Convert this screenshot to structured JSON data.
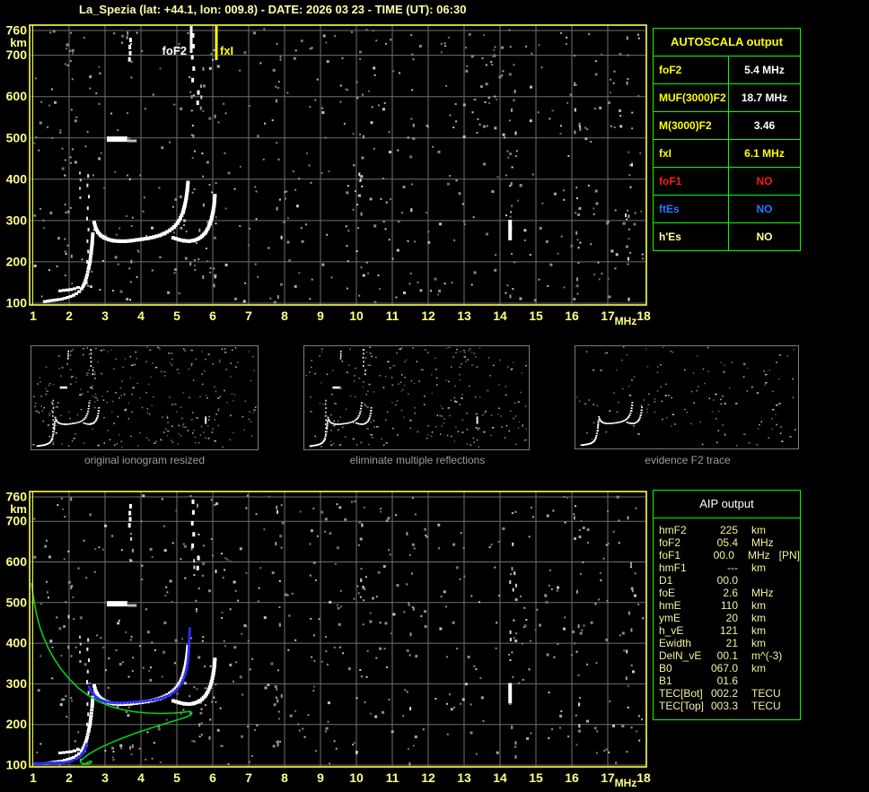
{
  "header": {
    "title": "La_Spezia (lat: +44.1, lon: 009.8) - DATE: 2026 03 23 - TIME (UT): 06:30"
  },
  "colors": {
    "background": "#000000",
    "plot_border": "#ffff4a",
    "grid": "#6f6f6f",
    "axis_text": "#ffff8c",
    "trace": "#ffffff",
    "noise": "#8c8c8c",
    "profile_green": "#00d020",
    "restored_blue": "#2c2cff",
    "table_border": "#00ff00",
    "caption_gray": "#9c9c9c",
    "aip_text": "#f2f2a2"
  },
  "autoscala_table": {
    "title": "AUTOSCALA output",
    "rows": [
      {
        "label": "foF2",
        "value": "5.4 MHz",
        "label_color": "#ffff00",
        "value_color": "#ffffff"
      },
      {
        "label": "MUF(3000)F2",
        "value": "18.7 MHz",
        "label_color": "#ffff00",
        "value_color": "#ffffff"
      },
      {
        "label": "M(3000)F2",
        "value": "3.46",
        "label_color": "#ffff00",
        "value_color": "#ffffff"
      },
      {
        "label": "fxI",
        "value": "6.1 MHz",
        "label_color": "#ffff00",
        "value_color": "#ffff00"
      },
      {
        "label": "foF1",
        "value": "NO",
        "label_color": "#ff1a1a",
        "value_color": "#ff1a1a"
      },
      {
        "label": "ftEs",
        "value": "NO",
        "label_color": "#2979ff",
        "value_color": "#2979ff"
      },
      {
        "label": "h'Es",
        "value": "NO",
        "label_color": "#ffff9e",
        "value_color": "#ffff9e"
      }
    ]
  },
  "aip_table": {
    "title": "AIP output",
    "rows": [
      {
        "label": "hmF2",
        "value": "225",
        "unit": "km",
        "extra": ""
      },
      {
        "label": "foF2",
        "value": "05.4",
        "unit": "MHz",
        "extra": ""
      },
      {
        "label": "foF1",
        "value": "00.0",
        "unit": "MHz",
        "extra": "[PN]"
      },
      {
        "label": "hmF1",
        "value": "---",
        "unit": "km",
        "extra": ""
      },
      {
        "label": "D1",
        "value": "00.0",
        "unit": "",
        "extra": ""
      },
      {
        "label": "foE",
        "value": "2.6",
        "unit": "MHz",
        "extra": ""
      },
      {
        "label": "hmE",
        "value": "110",
        "unit": "km",
        "extra": ""
      },
      {
        "label": "ymE",
        "value": "20",
        "unit": "km",
        "extra": ""
      },
      {
        "label": "h_vE",
        "value": "121",
        "unit": "km",
        "extra": ""
      },
      {
        "label": "Ewidth",
        "value": "21",
        "unit": "km",
        "extra": ""
      },
      {
        "label": "DelN_vE",
        "value": "00.1",
        "unit": "m^(-3)",
        "extra": ""
      },
      {
        "label": "B0",
        "value": "067.0",
        "unit": "km",
        "extra": ""
      },
      {
        "label": "B1",
        "value": "01.6",
        "unit": "",
        "extra": ""
      },
      {
        "label": "TEC[Bot]",
        "value": "002.2",
        "unit": "TECU",
        "extra": ""
      },
      {
        "label": "TEC[Top]",
        "value": "003.3",
        "unit": "TECU",
        "extra": ""
      }
    ]
  },
  "thumbnails": [
    {
      "caption": "original ionogram resized"
    },
    {
      "caption": "eliminate multiple reflections"
    },
    {
      "caption": "evidence F2 trace"
    }
  ],
  "chart_data": [
    {
      "type": "scatter",
      "title": "autoscaled ionogram",
      "xlabel": "MHz",
      "ylabel": "km",
      "xlim": [
        1,
        18
      ],
      "ylim": [
        100,
        760
      ],
      "grid": true,
      "x_ticks": [
        1,
        2,
        3,
        4,
        5,
        6,
        7,
        8,
        9,
        10,
        11,
        12,
        13,
        14,
        15,
        16,
        17,
        18
      ],
      "y_ticks": [
        760,
        700,
        600,
        500,
        400,
        300,
        200,
        100
      ],
      "markers": [
        {
          "label": "foF2",
          "freq_mhz": 5.4,
          "color": "#ffffff",
          "label_side": "left"
        },
        {
          "label": "fxI",
          "freq_mhz": 6.1,
          "color": "#ffff00",
          "label_side": "right"
        }
      ],
      "series": [
        {
          "name": "E_trace",
          "style": "trace",
          "thickness": 3,
          "points": [
            [
              1.32,
              104
            ],
            [
              1.4,
              105
            ],
            [
              1.48,
              106
            ],
            [
              1.56,
              107
            ],
            [
              1.64,
              108
            ],
            [
              1.72,
              109
            ],
            [
              1.8,
              110
            ],
            [
              1.88,
              112
            ],
            [
              1.96,
              114
            ],
            [
              2.04,
              116
            ],
            [
              2.12,
              119
            ],
            [
              2.2,
              123
            ],
            [
              2.28,
              128
            ],
            [
              2.35,
              135
            ],
            [
              2.41,
              144
            ],
            [
              2.46,
              155
            ],
            [
              2.5,
              168
            ],
            [
              2.54,
              183
            ],
            [
              2.58,
              200
            ],
            [
              2.61,
              220
            ],
            [
              2.64,
              243
            ],
            [
              2.66,
              268
            ]
          ]
        },
        {
          "name": "E_echo",
          "style": "trace",
          "thickness": 3,
          "points": [
            [
              1.75,
              130
            ],
            [
              1.85,
              131
            ],
            [
              1.95,
              132
            ],
            [
              2.05,
              133
            ],
            [
              2.15,
              135
            ],
            [
              2.25,
              138
            ]
          ]
        },
        {
          "name": "F2_O_trace",
          "style": "trace",
          "thickness": 4,
          "points": [
            [
              2.7,
              295
            ],
            [
              2.74,
              282
            ],
            [
              2.8,
              272
            ],
            [
              2.88,
              264
            ],
            [
              2.98,
              258
            ],
            [
              3.1,
              254
            ],
            [
              3.24,
              251
            ],
            [
              3.4,
              250
            ],
            [
              3.56,
              250
            ],
            [
              3.72,
              251
            ],
            [
              3.88,
              253
            ],
            [
              4.04,
              255
            ],
            [
              4.2,
              257
            ],
            [
              4.36,
              260
            ],
            [
              4.52,
              264
            ],
            [
              4.66,
              269
            ],
            [
              4.8,
              276
            ],
            [
              4.92,
              284
            ],
            [
              5.02,
              294
            ],
            [
              5.1,
              306
            ],
            [
              5.17,
              320
            ],
            [
              5.22,
              336
            ],
            [
              5.26,
              354
            ],
            [
              5.29,
              373
            ],
            [
              5.31,
              392
            ]
          ]
        },
        {
          "name": "F2_X_trace",
          "style": "trace",
          "thickness": 4,
          "points": [
            [
              4.9,
              258
            ],
            [
              5.05,
              254
            ],
            [
              5.2,
              251
            ],
            [
              5.35,
              250
            ],
            [
              5.48,
              252
            ],
            [
              5.6,
              256
            ],
            [
              5.7,
              262
            ],
            [
              5.79,
              270
            ],
            [
              5.86,
              280
            ],
            [
              5.92,
              292
            ],
            [
              5.97,
              306
            ],
            [
              6.01,
              322
            ],
            [
              6.04,
              340
            ],
            [
              6.06,
              360
            ]
          ]
        },
        {
          "name": "E_spread_column",
          "style": "dots",
          "points": [
            [
              2.49,
              150
            ],
            [
              2.52,
              175
            ],
            [
              2.5,
              200
            ],
            [
              2.53,
              225
            ],
            [
              2.51,
              250
            ],
            [
              2.54,
              278
            ],
            [
              2.5,
              305
            ],
            [
              2.52,
              330
            ],
            [
              2.55,
              358
            ],
            [
              2.51,
              385
            ],
            [
              2.53,
              408
            ]
          ]
        },
        {
          "name": "spread_column_2",
          "style": "dots",
          "points": [
            [
              2.31,
              355
            ],
            [
              2.3,
              378
            ],
            [
              2.32,
              398
            ],
            [
              2.3,
              415
            ]
          ]
        },
        {
          "name": "high_altitude_echoes",
          "style": "dots",
          "points": [
            [
              3.68,
              690
            ],
            [
              3.7,
              705
            ],
            [
              3.69,
              720
            ],
            [
              3.71,
              737
            ],
            [
              5.44,
              640
            ],
            [
              5.47,
              668
            ],
            [
              5.43,
              695
            ],
            [
              5.46,
              722
            ],
            [
              5.45,
              748
            ],
            [
              5.6,
              610
            ],
            [
              5.58,
              585
            ]
          ]
        }
      ],
      "features": {
        "blob_500km": {
          "mhz1": 3.05,
          "mhz2": 3.62,
          "km": 497
        },
        "blob_tail": {
          "mhz1": 3.62,
          "mhz2": 3.88,
          "km": 494
        },
        "dash_14mhz": {
          "mhz": 14.28,
          "km1": 252,
          "km2": 302
        }
      }
    },
    {
      "type": "line",
      "title": "restored trace and electron density profile",
      "xlabel": "MHz",
      "ylabel": "km",
      "xlim": [
        1,
        18
      ],
      "ylim": [
        100,
        760
      ],
      "grid": true,
      "series": [
        {
          "name": "electron_density_profile",
          "color": "#00d020",
          "points": [
            [
              0.95,
              548
            ],
            [
              0.99,
              522
            ],
            [
              1.04,
              495
            ],
            [
              1.1,
              468
            ],
            [
              1.18,
              441
            ],
            [
              1.29,
              414
            ],
            [
              1.42,
              388
            ],
            [
              1.58,
              362
            ],
            [
              1.77,
              337
            ],
            [
              1.99,
              313
            ],
            [
              2.24,
              291
            ],
            [
              2.52,
              272
            ],
            [
              2.83,
              256
            ],
            [
              3.16,
              244
            ],
            [
              3.5,
              236
            ],
            [
              3.85,
              231
            ],
            [
              4.2,
              228
            ],
            [
              4.55,
              227
            ],
            [
              4.9,
              228
            ],
            [
              5.18,
              230
            ],
            [
              5.36,
              232
            ],
            [
              5.42,
              228
            ],
            [
              5.4,
              224
            ],
            [
              5.28,
              219
            ],
            [
              5.08,
              213
            ],
            [
              4.82,
              206
            ],
            [
              4.52,
              198
            ],
            [
              4.2,
              189
            ],
            [
              3.86,
              179
            ],
            [
              3.53,
              168
            ],
            [
              3.22,
              157
            ],
            [
              2.94,
              146
            ],
            [
              2.72,
              136
            ],
            [
              2.55,
              127
            ],
            [
              2.43,
              119
            ],
            [
              2.35,
              113
            ],
            [
              2.31,
              108
            ],
            [
              2.34,
              105
            ],
            [
              2.43,
              103
            ],
            [
              2.55,
              103
            ],
            [
              2.62,
              106
            ],
            [
              2.61,
              110
            ],
            [
              2.52,
              107
            ],
            [
              2.42,
              102
            ],
            [
              2.36,
              100
            ]
          ]
        },
        {
          "name": "restored_trace_E",
          "color": "#2c2cff",
          "points": [
            [
              1.02,
              104
            ],
            [
              1.14,
              104
            ],
            [
              1.26,
              104
            ],
            [
              1.38,
              105
            ],
            [
              1.5,
              105
            ],
            [
              1.62,
              105
            ],
            [
              1.74,
              106
            ],
            [
              1.86,
              106
            ],
            [
              1.98,
              108
            ],
            [
              2.1,
              111
            ],
            [
              2.2,
              115
            ],
            [
              2.3,
              121
            ],
            [
              2.38,
              129
            ],
            [
              2.44,
              139
            ],
            [
              2.49,
              151
            ]
          ]
        },
        {
          "name": "restored_trace_F",
          "color": "#2c2cff",
          "points": [
            [
              2.56,
              292
            ],
            [
              2.61,
              283
            ],
            [
              2.68,
              274
            ],
            [
              2.77,
              266
            ],
            [
              2.88,
              260
            ],
            [
              3.01,
              256
            ],
            [
              3.16,
              254
            ],
            [
              3.32,
              253
            ],
            [
              3.49,
              253
            ],
            [
              3.66,
              254
            ],
            [
              3.83,
              255
            ],
            [
              4.0,
              256
            ],
            [
              4.17,
              258
            ],
            [
              4.34,
              260
            ],
            [
              4.5,
              263
            ],
            [
              4.65,
              267
            ],
            [
              4.79,
              272
            ],
            [
              4.91,
              279
            ],
            [
              5.01,
              287
            ],
            [
              5.1,
              297
            ],
            [
              5.17,
              309
            ],
            [
              5.23,
              323
            ],
            [
              5.28,
              339
            ],
            [
              5.31,
              357
            ],
            [
              5.33,
              376
            ],
            [
              5.34,
              396
            ],
            [
              5.35,
              416
            ],
            [
              5.36,
              436
            ]
          ]
        }
      ]
    }
  ]
}
